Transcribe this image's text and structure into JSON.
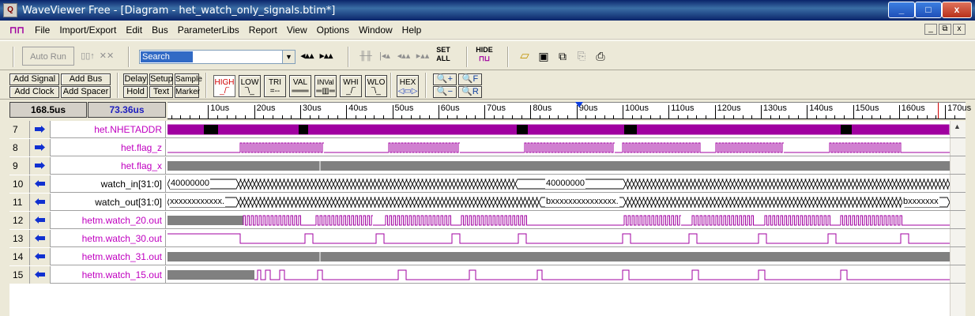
{
  "window": {
    "title": "WaveViewer Free - [Diagram - het_watch_only_signals.btim*]",
    "controls": [
      "_",
      "□",
      "x"
    ],
    "mdi_controls": [
      "_",
      "⧉",
      "x"
    ]
  },
  "menu": [
    "File",
    "Import/Export",
    "Edit",
    "Bus",
    "ParameterLibs",
    "Report",
    "View",
    "Options",
    "Window",
    "Help"
  ],
  "toolbar1": {
    "auto_run": "Auto Run",
    "search_value": "Search",
    "set_all": [
      "SET",
      "ALL"
    ],
    "hide": "HIDE"
  },
  "toolbar2": {
    "add_signal": "Add Signal",
    "add_bus": "Add Bus",
    "add_clock": "Add Clock",
    "add_spacer": "Add Spacer",
    "delay": "Delay",
    "setup": "Setup",
    "sample": "Sample",
    "hold": "Hold",
    "text": "Text",
    "marker": "Marker",
    "state_buttons": [
      "HIGH",
      "LOW",
      "TRI",
      "VAL",
      "INVal",
      "WHI",
      "WLO"
    ],
    "hex": "HEX",
    "zoom_in": "+",
    "zoom_f": "F",
    "zoom_out": "−",
    "zoom_r": "R"
  },
  "times": {
    "left": "168.5us",
    "right": "73.36us"
  },
  "ruler": {
    "labels": [
      "10us",
      "20us",
      "30us",
      "40us",
      "50us",
      "60us",
      "70us",
      "80us",
      "90us",
      "100us",
      "110us",
      "120us",
      "130us",
      "140us",
      "150us",
      "160us",
      "170us"
    ],
    "cursor_time_us": 90.5,
    "marker_time_us": 168.5
  },
  "signals": [
    {
      "num": "7",
      "dir": "in",
      "name": "het.NHETADDR",
      "color": "#c000c0"
    },
    {
      "num": "8",
      "dir": "in",
      "name": "het.flag_z",
      "color": "#c000c0"
    },
    {
      "num": "9",
      "dir": "in",
      "name": "het.flag_x",
      "color": "#c000c0"
    },
    {
      "num": "10",
      "dir": "out",
      "name": "watch_in[31:0]",
      "color": "#000000",
      "values": [
        "40000000",
        "40000000"
      ]
    },
    {
      "num": "11",
      "dir": "out",
      "name": "watch_out[31:0]",
      "color": "#000000",
      "values": [
        "xxxxxxxxxxxx.",
        "bxxxxxxxxxxxxxxx.",
        "bxxxxxxx"
      ]
    },
    {
      "num": "12",
      "dir": "out",
      "name": "hetm.watch_20.out",
      "color": "#c000c0"
    },
    {
      "num": "13",
      "dir": "out",
      "name": "hetm.watch_30.out",
      "color": "#c000c0"
    },
    {
      "num": "14",
      "dir": "out",
      "name": "hetm.watch_31.out",
      "color": "#c000c0"
    },
    {
      "num": "15",
      "dir": "out",
      "name": "hetm.watch_15.out",
      "color": "#c000c0"
    }
  ],
  "colors": {
    "wave": "#a000a0",
    "grey_fill": "#808080",
    "signal_name": "#c000c0"
  }
}
